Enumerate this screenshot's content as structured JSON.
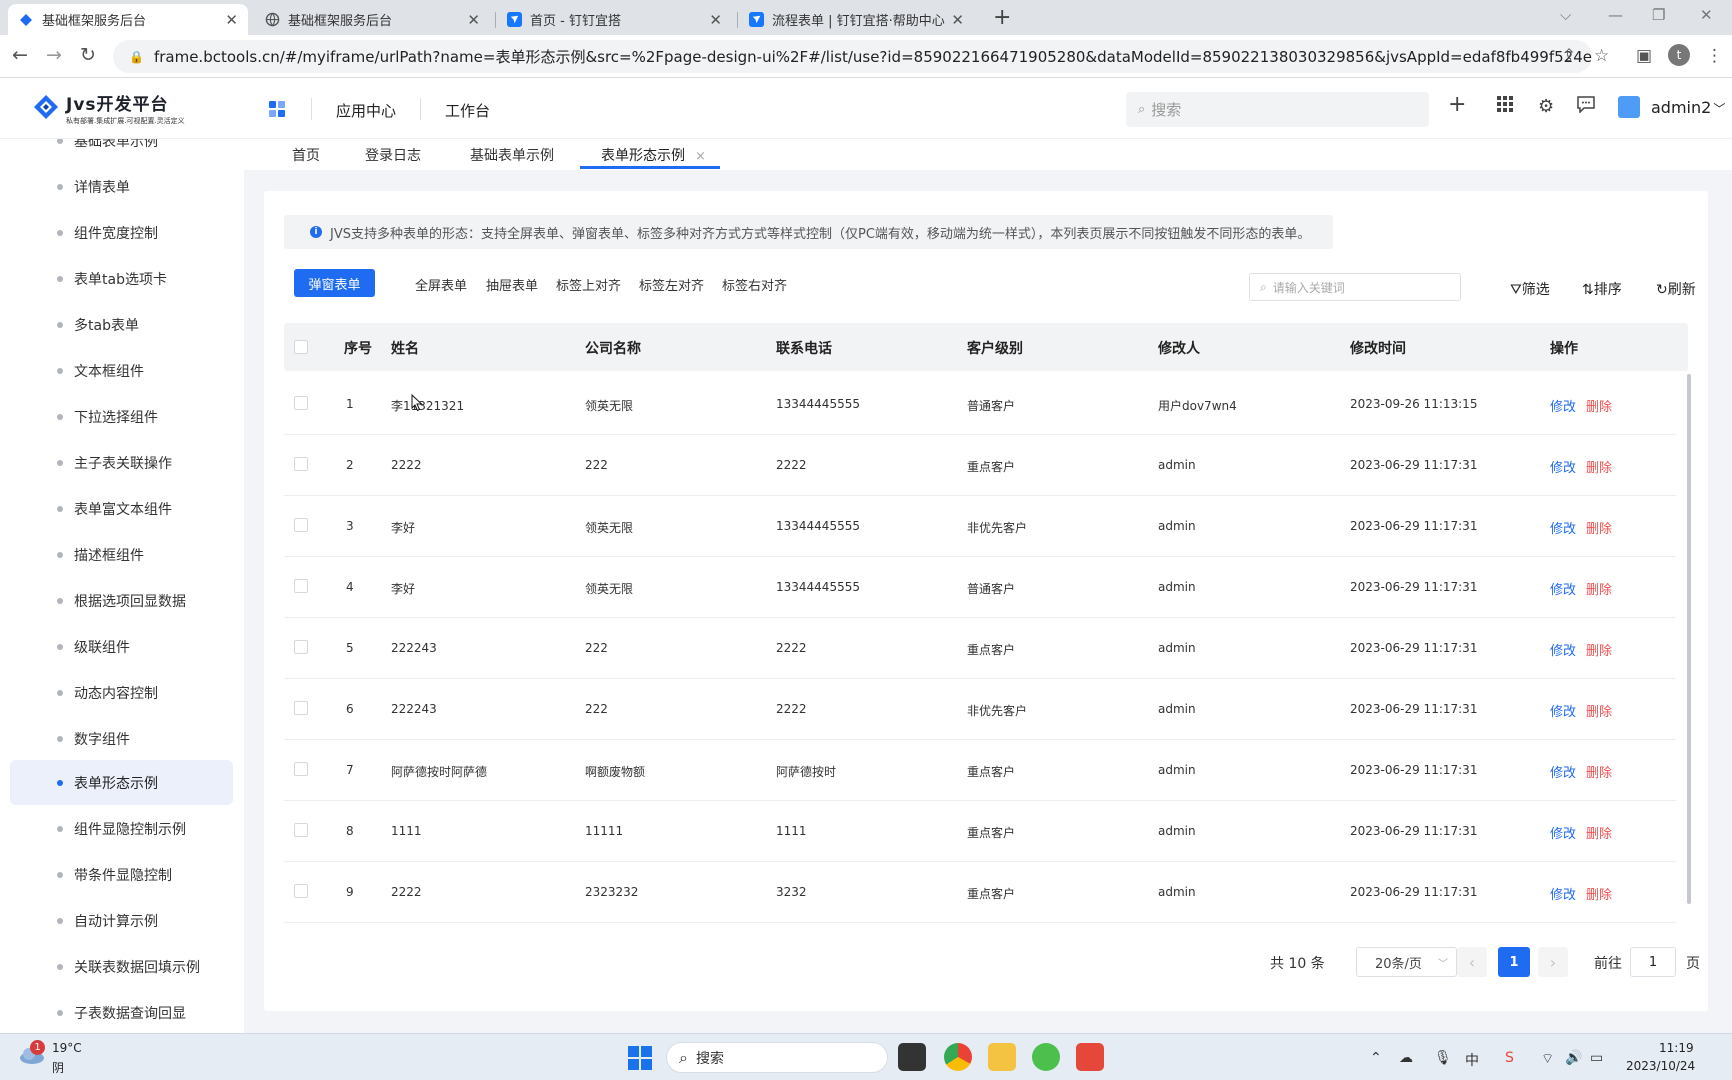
{
  "browser": {
    "tabs": [
      {
        "title": "基础框架服务后台",
        "active": true
      },
      {
        "title": "基础框架服务后台",
        "active": false
      },
      {
        "title": "首页 - 钉钉宜搭",
        "active": false
      },
      {
        "title": "流程表单 | 钉钉宜搭·帮助中心",
        "active": false
      }
    ],
    "new_tab": "+",
    "url": "frame.bctools.cn/#/myiframe/urlPath?name=表单形态示例&src=%2Fpage-design-ui%2F#/list/use?id=859022166471905280&dataModelId=859022138030329856&jvsAppId=edaf8fb499f524e7a5fafc81cd04...",
    "profile_letter": "t"
  },
  "header": {
    "logo_name": "Jvs开发平台",
    "logo_slogan": "私有部署.集成扩展.可视配置.灵活定义",
    "nav": [
      "应用中心",
      "工作台"
    ],
    "search_placeholder": "搜索",
    "user": "admin2"
  },
  "sidebar": {
    "items": [
      {
        "label": "基础表单示例",
        "active": false
      },
      {
        "label": "详情表单",
        "active": false
      },
      {
        "label": "组件宽度控制",
        "active": false
      },
      {
        "label": "表单tab选项卡",
        "active": false
      },
      {
        "label": "多tab表单",
        "active": false
      },
      {
        "label": "文本框组件",
        "active": false
      },
      {
        "label": "下拉选择组件",
        "active": false
      },
      {
        "label": "主子表关联操作",
        "active": false
      },
      {
        "label": "表单富文本组件",
        "active": false
      },
      {
        "label": "描述框组件",
        "active": false
      },
      {
        "label": "根据选项回显数据",
        "active": false
      },
      {
        "label": "级联组件",
        "active": false
      },
      {
        "label": "动态内容控制",
        "active": false
      },
      {
        "label": "数字组件",
        "active": false
      },
      {
        "label": "表单形态示例",
        "active": true
      },
      {
        "label": "组件显隐控制示例",
        "active": false
      },
      {
        "label": "带条件显隐控制",
        "active": false
      },
      {
        "label": "自动计算示例",
        "active": false
      },
      {
        "label": "关联表数据回填示例",
        "active": false
      },
      {
        "label": "子表数据查询回显",
        "active": false
      }
    ]
  },
  "page_tabs": [
    {
      "label": "首页",
      "active": false
    },
    {
      "label": "登录日志",
      "active": false
    },
    {
      "label": "基础表单示例",
      "active": false
    },
    {
      "label": "表单形态示例",
      "active": true,
      "closable": "×"
    }
  ],
  "notice": "JVS支持多种表单的形态：支持全屏表单、弹窗表单、标签多种对齐方式方式等样式控制（仅PC端有效，移动端为统一样式），本列表页展示不同按钮触发不同形态的表单。",
  "toolbar": {
    "primary": "弹窗表单",
    "buttons": [
      "全屏表单",
      "抽屉表单",
      "标签上对齐",
      "标签左对齐",
      "标签右对齐"
    ],
    "keyword_placeholder": "请输入关键词",
    "filter": "筛选",
    "sort": "排序",
    "refresh": "刷新"
  },
  "table": {
    "columns": [
      "序号",
      "姓名",
      "公司名称",
      "联系电话",
      "客户级别",
      "修改人",
      "修改时间",
      "操作"
    ],
    "edit_label": "修改",
    "delete_label": "删除",
    "rows": [
      [
        "1",
        "李11321321",
        "领英无限",
        "13344445555",
        "普通客户",
        "用户dov7wn4",
        "2023-09-26 11:13:15"
      ],
      [
        "2",
        "2222",
        "222",
        "2222",
        "重点客户",
        "admin",
        "2023-06-29 11:17:31"
      ],
      [
        "3",
        "李好",
        "领英无限",
        "13344445555",
        "非优先客户",
        "admin",
        "2023-06-29 11:17:31"
      ],
      [
        "4",
        "李好",
        "领英无限",
        "13344445555",
        "普通客户",
        "admin",
        "2023-06-29 11:17:31"
      ],
      [
        "5",
        "222243",
        "222",
        "2222",
        "重点客户",
        "admin",
        "2023-06-29 11:17:31"
      ],
      [
        "6",
        "222243",
        "222",
        "2222",
        "非优先客户",
        "admin",
        "2023-06-29 11:17:31"
      ],
      [
        "7",
        "阿萨德按时阿萨德",
        "啊额废物额",
        "阿萨德按时",
        "重点客户",
        "admin",
        "2023-06-29 11:17:31"
      ],
      [
        "8",
        "1111",
        "11111",
        "1111",
        "重点客户",
        "admin",
        "2023-06-29 11:17:31"
      ],
      [
        "9",
        "2222",
        "2323232",
        "3232",
        "重点客户",
        "admin",
        "2023-06-29 11:17:31"
      ]
    ]
  },
  "pagination": {
    "total": "共 10 条",
    "page_size": "20条/页",
    "current": "1",
    "goto_label": "前往",
    "goto_value": "1",
    "page_suffix": "页"
  },
  "taskbar": {
    "weather_temp": "19°C",
    "weather_desc": "阴",
    "weather_badge": "1",
    "search": "搜索",
    "time": "11:19",
    "date": "2023/10/24"
  }
}
